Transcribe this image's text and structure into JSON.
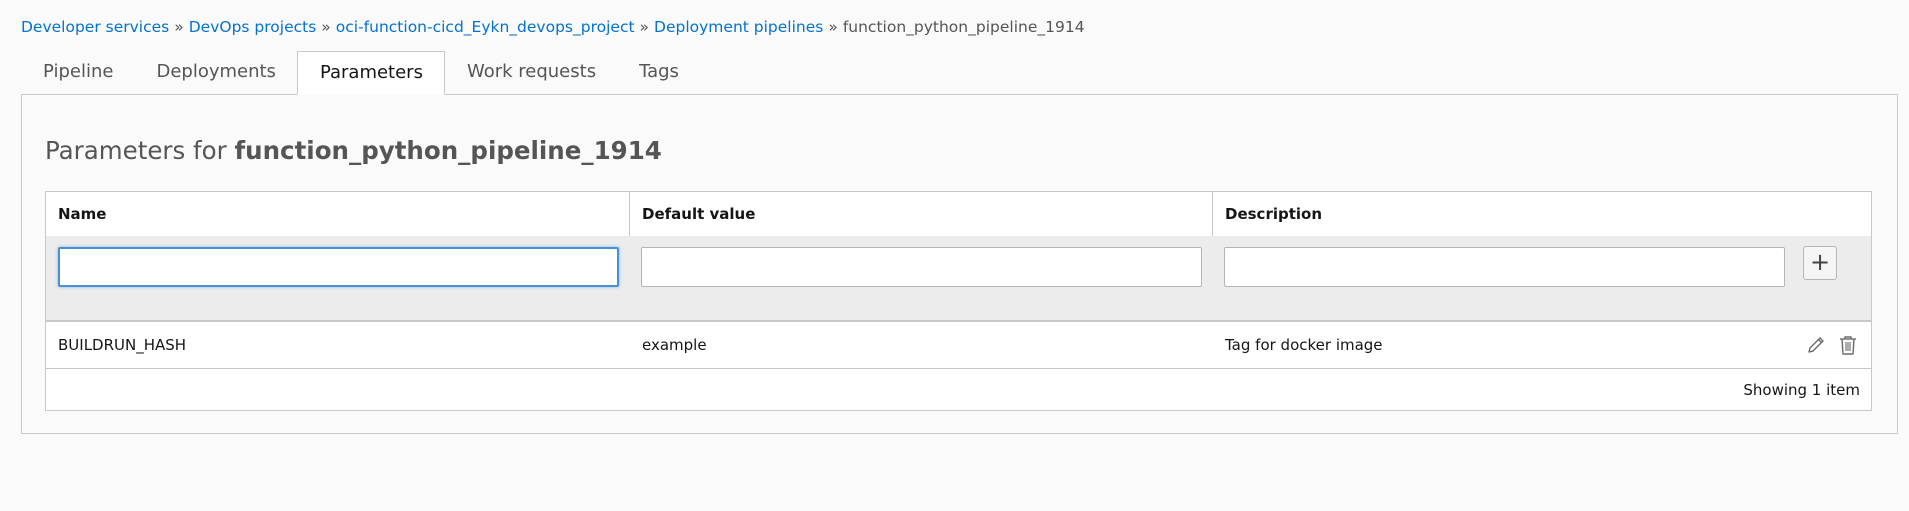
{
  "breadcrumb": {
    "items": [
      {
        "label": "Developer services"
      },
      {
        "label": "DevOps projects"
      },
      {
        "label": "oci-function-cicd_Eykn_devops_project"
      },
      {
        "label": "Deployment pipelines"
      }
    ],
    "separator": "»",
    "current": "function_python_pipeline_1914"
  },
  "tabs": [
    {
      "label": "Pipeline"
    },
    {
      "label": "Deployments"
    },
    {
      "label": "Parameters",
      "active": true
    },
    {
      "label": "Work requests"
    },
    {
      "label": "Tags"
    }
  ],
  "panel": {
    "title_prefix": "Parameters for",
    "title_name": "function_python_pipeline_1914"
  },
  "table": {
    "columns": [
      {
        "label": "Name"
      },
      {
        "label": "Default value"
      },
      {
        "label": "Description"
      }
    ],
    "new_row": {
      "name": "",
      "default_value": "",
      "description": "",
      "add_label": "+"
    },
    "rows": [
      {
        "name": "BUILDRUN_HASH",
        "default_value": "example",
        "description": "Tag for docker image"
      }
    ],
    "footer": "Showing 1 item"
  },
  "icons": {
    "edit": "pencil-icon",
    "delete": "trash-icon"
  },
  "colors": {
    "link": "#0572ce",
    "focus": "#4a90d9"
  }
}
